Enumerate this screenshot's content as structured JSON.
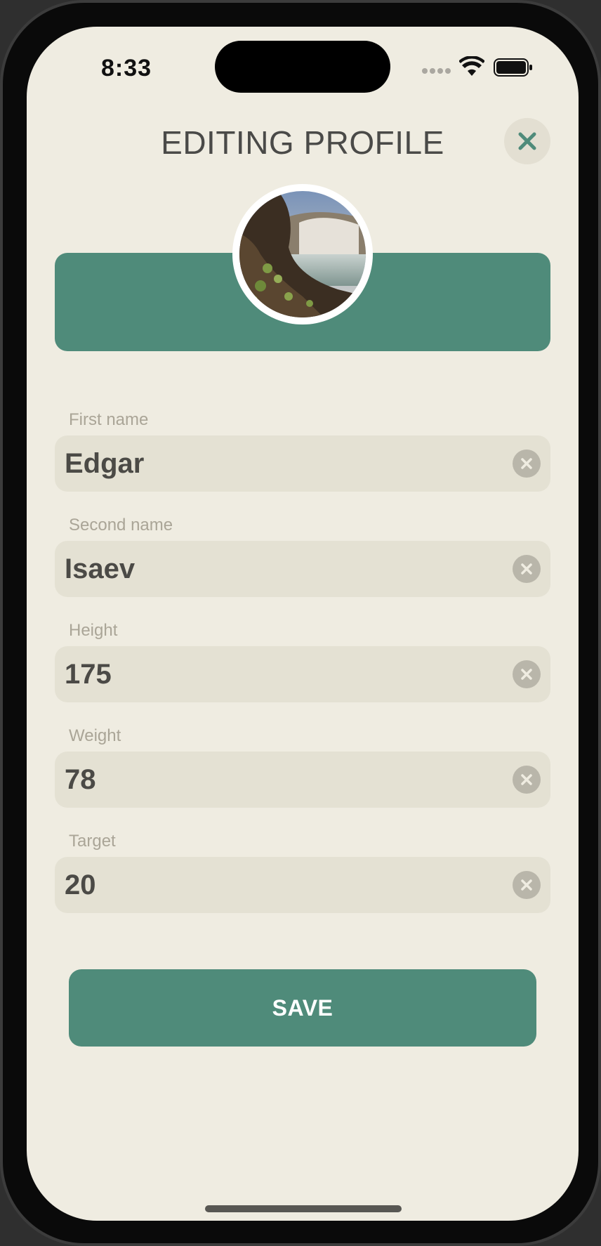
{
  "status_bar": {
    "time": "8:33"
  },
  "header": {
    "title": "EDITING PROFILE"
  },
  "form": {
    "fields": [
      {
        "label": "First name",
        "value": "Edgar"
      },
      {
        "label": "Second name",
        "value": "Isaev"
      },
      {
        "label": "Height",
        "value": "175"
      },
      {
        "label": "Weight",
        "value": "78"
      },
      {
        "label": "Target",
        "value": "20"
      }
    ]
  },
  "save_button": {
    "label": "SAVE"
  },
  "icons": {
    "close": "close-icon",
    "clear": "clear-circle-icon",
    "wifi": "wifi-icon",
    "battery": "battery-icon",
    "signal": "signal-icon"
  },
  "colors": {
    "accent": "#4f8b7a",
    "background": "#efece1",
    "field_background": "#e4e1d3",
    "text": "#4b4a46",
    "label": "#aaa597"
  }
}
